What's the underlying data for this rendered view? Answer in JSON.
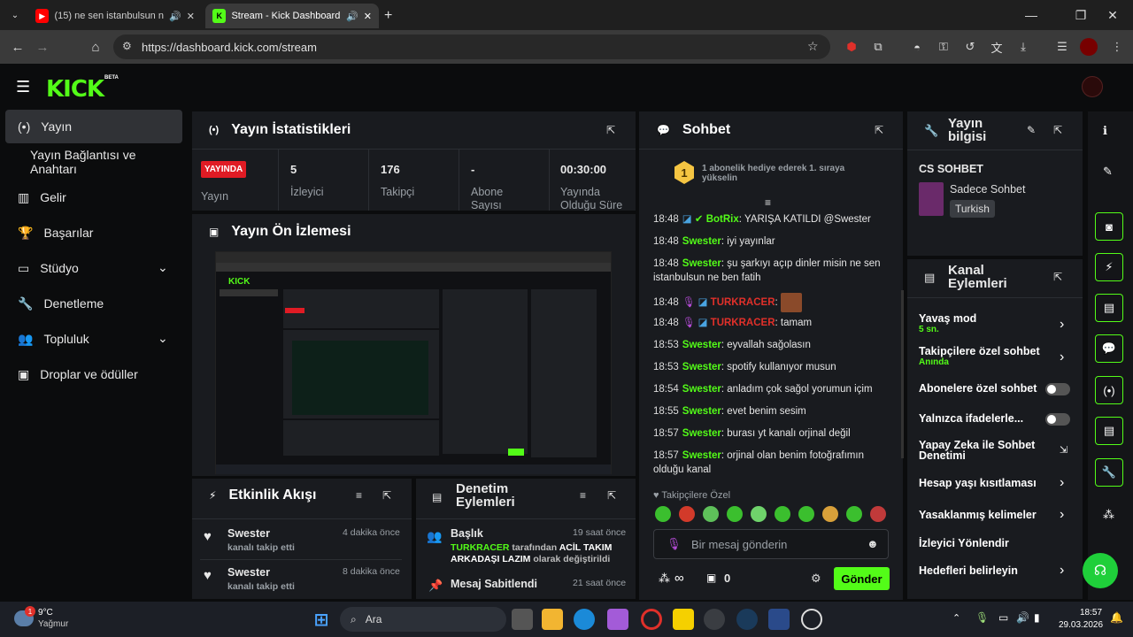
{
  "browser": {
    "tabs": [
      {
        "title": "(15) ne sen istanbulsun ne b",
        "icon": "youtube-icon"
      },
      {
        "title": "Stream - Kick Dashboard",
        "icon": "kick-icon"
      }
    ],
    "url": "https://dashboard.kick.com/stream"
  },
  "brand": {
    "logo": "KICK",
    "beta": "BETA"
  },
  "sidebar": {
    "items": [
      {
        "label": "Yayın",
        "icon": "broadcast-icon"
      },
      {
        "label": "Yayın Bağlantısı ve Anahtarı"
      },
      {
        "label": "Gelir",
        "icon": "chart-icon"
      },
      {
        "label": "Başarılar",
        "icon": "trophy-icon"
      },
      {
        "label": "Stüdyo",
        "icon": "monitor-icon"
      },
      {
        "label": "Denetleme",
        "icon": "wrench-icon"
      },
      {
        "label": "Topluluk",
        "icon": "people-icon"
      },
      {
        "label": "Droplar ve ödüller",
        "icon": "gift-icon"
      }
    ]
  },
  "stats": {
    "title": "Yayın İstatistikleri",
    "live_badge": "YAYINDA",
    "cells": [
      {
        "value": "",
        "label": "Yayın"
      },
      {
        "value": "5",
        "label": "İzleyici"
      },
      {
        "value": "176",
        "label": "Takipçi"
      },
      {
        "value": "-",
        "label": "Abone Sayısı"
      },
      {
        "value": "00:30:00",
        "label": "Yayında Olduğu Süre"
      }
    ]
  },
  "preview": {
    "title": "Yayın Ön İzlemesi"
  },
  "activity": {
    "title": "Etkinlik Akışı",
    "items": [
      {
        "name": "Swester",
        "action": "kanalı takip etti",
        "time": "4 dakika önce"
      },
      {
        "name": "Swester",
        "action": "kanalı takip etti",
        "time": "8 dakika önce"
      }
    ]
  },
  "modactions": {
    "title": "Denetim Eylemleri",
    "items": [
      {
        "title": "Başlık",
        "time": "19 saat önce",
        "user": "TURKRACER",
        "mid": "tarafından",
        "value": "ACİL TAKIM ARKADAŞI LAZIM",
        "end": "olarak değiştirildi"
      },
      {
        "title": "Mesaj Sabitlendi",
        "time": "21 saat önce"
      }
    ]
  },
  "chat": {
    "title": "Sohbet",
    "gift_rank": "1",
    "gift_text": "1 abonelik hediye ederek 1. sıraya yükselin",
    "messages": [
      {
        "time": "18:48",
        "user": "BotRix",
        "text": "YARIŞA KATILDI @Swester",
        "badges": true
      },
      {
        "time": "18:48",
        "user": "Swester",
        "text": "iyi yayınlar"
      },
      {
        "time": "18:48",
        "user": "Swester",
        "text": "şu şarkıyı açıp dinler misin ne sen istanbulsun ne ben fatih"
      },
      {
        "time": "18:48",
        "user": "TURKRACER",
        "text": "",
        "badges": true,
        "red": true
      },
      {
        "time": "18:48",
        "user": "TURKRACER",
        "text": "tamam",
        "badges": true,
        "red": true
      },
      {
        "time": "18:53",
        "user": "Swester",
        "text": "eyvallah sağolasın"
      },
      {
        "time": "18:53",
        "user": "Swester",
        "text": "spotify kullanıyor musun"
      },
      {
        "time": "18:54",
        "user": "Swester",
        "text": "anladım çok sağol yorumun içim"
      },
      {
        "time": "18:55",
        "user": "Swester",
        "text": "evet benim sesim"
      },
      {
        "time": "18:57",
        "user": "Swester",
        "text": "burası yt kanalı orjinal değil"
      },
      {
        "time": "18:57",
        "user": "Swester",
        "text": "orjinal olan benim fotoğrafımın olduğu kanal"
      }
    ],
    "followers_only": "Takipçilere Özel",
    "placeholder": "Bir mesaj gönderin",
    "infinity": "∞",
    "count": "0",
    "send": "Gönder"
  },
  "streaminfo": {
    "title": "Yayın bilgisi",
    "stream_title": "CS SOHBET",
    "category": "Sadece Sohbet",
    "language": "Turkish"
  },
  "channel": {
    "title": "Kanal Eylemleri",
    "rows": [
      {
        "label": "Yavaş mod",
        "sub": "5 sn."
      },
      {
        "label": "Takipçilere özel sohbet",
        "sub": "Anında"
      },
      {
        "label": "Abonelere özel sohbet"
      },
      {
        "label": "Yalnızca ifadelerle..."
      },
      {
        "label": "Yapay Zeka ile Sohbet Denetimi"
      },
      {
        "label": "Hesap yaşı kısıtlaması"
      },
      {
        "label": "Yasaklanmış kelimeler"
      },
      {
        "label": "İzleyici Yönlendir"
      },
      {
        "label": "Hedefleri belirleyin"
      }
    ]
  },
  "taskbar": {
    "weather_temp": "9°C",
    "weather_text": "Yağmur",
    "weather_badge": "1",
    "search": "Ara",
    "time": "18:57",
    "date": "29.03.2026"
  },
  "colors": {
    "accent": "#53fc18",
    "live": "#e01b24",
    "panel": "#191b1f"
  }
}
